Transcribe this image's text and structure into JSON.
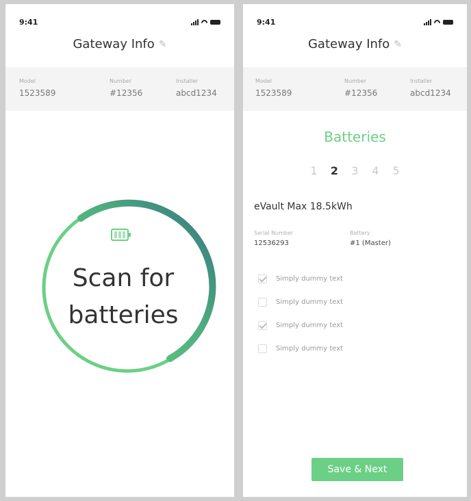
{
  "left_screen": {
    "status": {
      "time": "9:41"
    },
    "title": "Gateway Info",
    "info": [
      {
        "label": "Model",
        "value": "1523589"
      },
      {
        "label": "Number",
        "value": "#12356"
      },
      {
        "label": "Installer",
        "value": "abcd1234"
      }
    ],
    "scan": {
      "line1": "Scan for",
      "line2": "batteries"
    }
  },
  "right_screen": {
    "status": {
      "time": "9:41"
    },
    "title": "Gateway Info",
    "info": [
      {
        "label": "Model",
        "value": "1523589"
      },
      {
        "label": "Number",
        "value": "#12356"
      },
      {
        "label": "Installer",
        "value": "abcd1234"
      }
    ],
    "section_title": "Batteries",
    "pager": [
      "1",
      "2",
      "3",
      "4",
      "5"
    ],
    "pager_active": 2,
    "device_name": "eVault Max 18.5kWh",
    "specs": [
      {
        "label": "Serial Number",
        "value": "12536293"
      },
      {
        "label": "Battery",
        "value": "#1 (Master)"
      }
    ],
    "checklist": [
      {
        "label": "Simply dummy text",
        "checked": true
      },
      {
        "label": "Simply dummy text",
        "checked": false
      },
      {
        "label": "Simply dummy text",
        "checked": true
      },
      {
        "label": "Simply dummy text",
        "checked": false
      }
    ],
    "save_label": "Save & Next"
  },
  "colors": {
    "accent_green": "#6ccf86",
    "ring_teal": "#3a7f8a",
    "band_gray": "#f4f4f4"
  },
  "icons": [
    "cellular-signal-icon",
    "wifi-icon",
    "battery-status-icon",
    "pencil-edit-icon",
    "battery-icon",
    "checkmark-icon"
  ]
}
